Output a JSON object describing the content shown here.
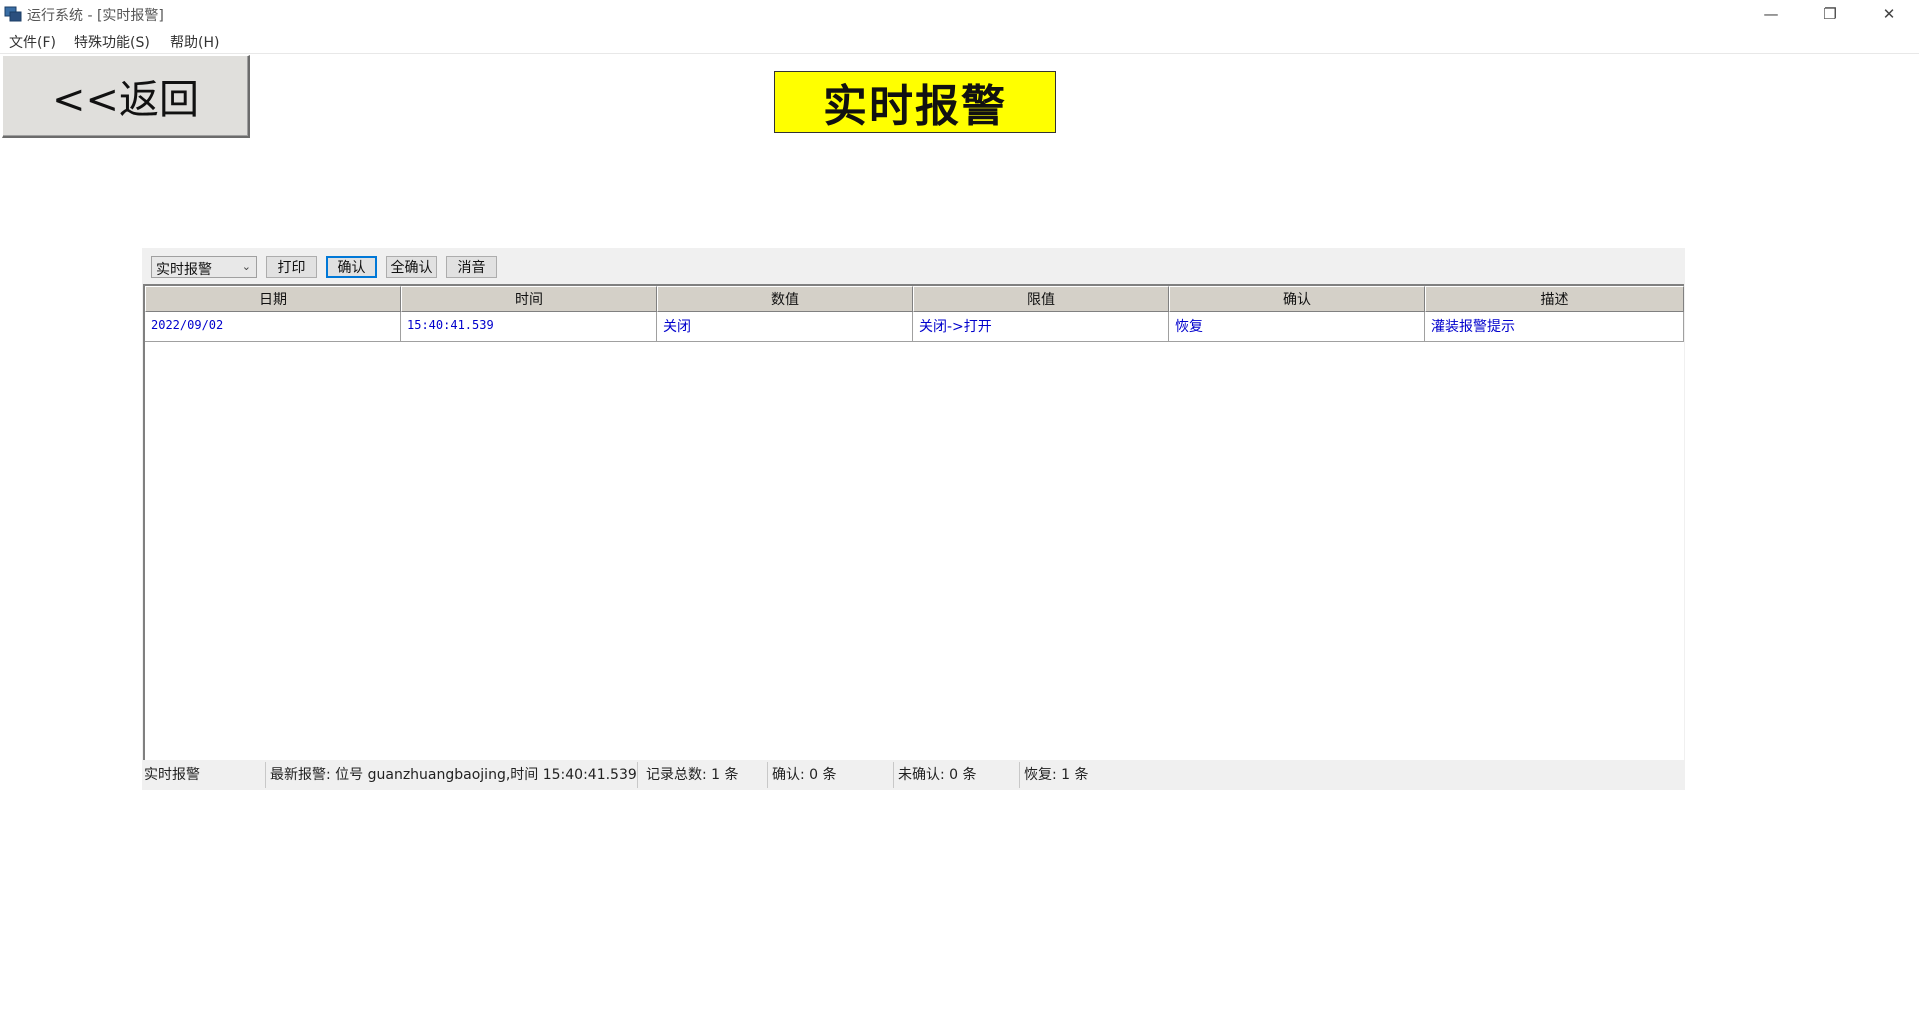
{
  "window": {
    "title": "运行系统 - [实时报警]",
    "controls": {
      "minimize": "—",
      "restore": "❐",
      "close": "✕"
    }
  },
  "menu": [
    {
      "label": "文件(F)"
    },
    {
      "label": "特殊功能(S)"
    },
    {
      "label": "帮助(H)"
    }
  ],
  "back_button": {
    "label": "<<返回"
  },
  "page_title": "实时报警",
  "toolbar": {
    "select_value": "实时报警",
    "buttons": {
      "print": "打印",
      "confirm": "确认",
      "confirm_all": "全确认",
      "silence": "消音"
    }
  },
  "table": {
    "columns": [
      "日期",
      "时间",
      "数值",
      "限值",
      "确认",
      "描述"
    ],
    "rows": [
      [
        "2022/09/02",
        "15:40:41.539",
        "关闭",
        "关闭->打开",
        "恢复",
        "灌装报警提示"
      ]
    ]
  },
  "status": {
    "mode": "实时报警",
    "latest": "最新报警: 位号 guanzhuangbaojing,时间 15:40:41.539",
    "total": "记录总数: 1 条",
    "confirmed": "确认: 0 条",
    "unconfirmed": "未确认: 0 条",
    "recovered": "恢复: 1 条"
  },
  "colors": {
    "title_box": "#ffff00",
    "row_text": "#0000cc",
    "focus_border": "#0078d7"
  }
}
